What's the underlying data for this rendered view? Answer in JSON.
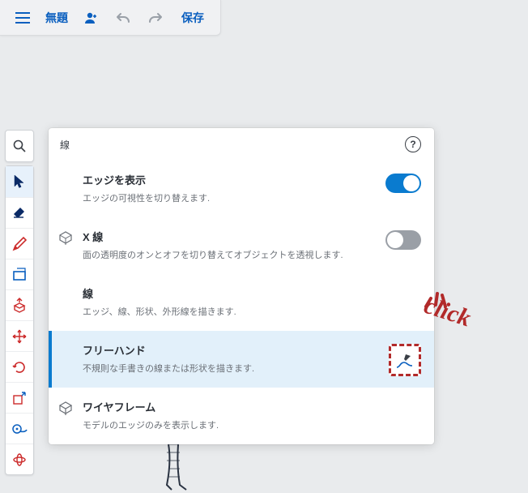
{
  "colors": {
    "accent": "#0a7bcf",
    "highlight": "#b22a2a",
    "topbarText": "#0a5fbf"
  },
  "topbar": {
    "title": "無題",
    "save_label": "保存",
    "icons": {
      "menu": "menu-icon",
      "user": "user-icon",
      "undo": "undo-icon",
      "redo": "redo-icon"
    }
  },
  "toolstrip": {
    "tools": [
      {
        "name": "search-icon"
      },
      {
        "name": "select-icon",
        "active": true
      },
      {
        "name": "eraser-icon"
      },
      {
        "name": "pencil-icon"
      },
      {
        "name": "rectangle-icon"
      },
      {
        "name": "push-pull-icon"
      },
      {
        "name": "move-icon"
      },
      {
        "name": "rotate-icon"
      },
      {
        "name": "scale-icon"
      },
      {
        "name": "tape-measure-icon"
      },
      {
        "name": "orbit-icon"
      }
    ]
  },
  "panel": {
    "title": "線",
    "help_label": "?",
    "items": [
      {
        "name": "edges",
        "title": "エッジを表示",
        "description": "エッジの可視性を切り替えます.",
        "control": "toggle",
        "value": true
      },
      {
        "name": "xray",
        "leading_icon": "xray-icon",
        "title": "X 線",
        "description": "面の透明度のオンとオフを切り替えてオブジェクトを透視します.",
        "control": "toggle",
        "value": false
      },
      {
        "name": "line",
        "title": "線",
        "description": "エッジ、線、形状、外形線を描きます."
      },
      {
        "name": "freehand",
        "title": "フリーハンド",
        "description": "不規則な手書きの線または形状を描きます.",
        "selected": true,
        "trailing_icon": "freehand-tool-icon"
      },
      {
        "name": "wireframe",
        "leading_icon": "wireframe-icon",
        "title": "ワイヤフレーム",
        "description": "モデルのエッジのみを表示します."
      }
    ]
  },
  "callout": {
    "label": "click"
  }
}
